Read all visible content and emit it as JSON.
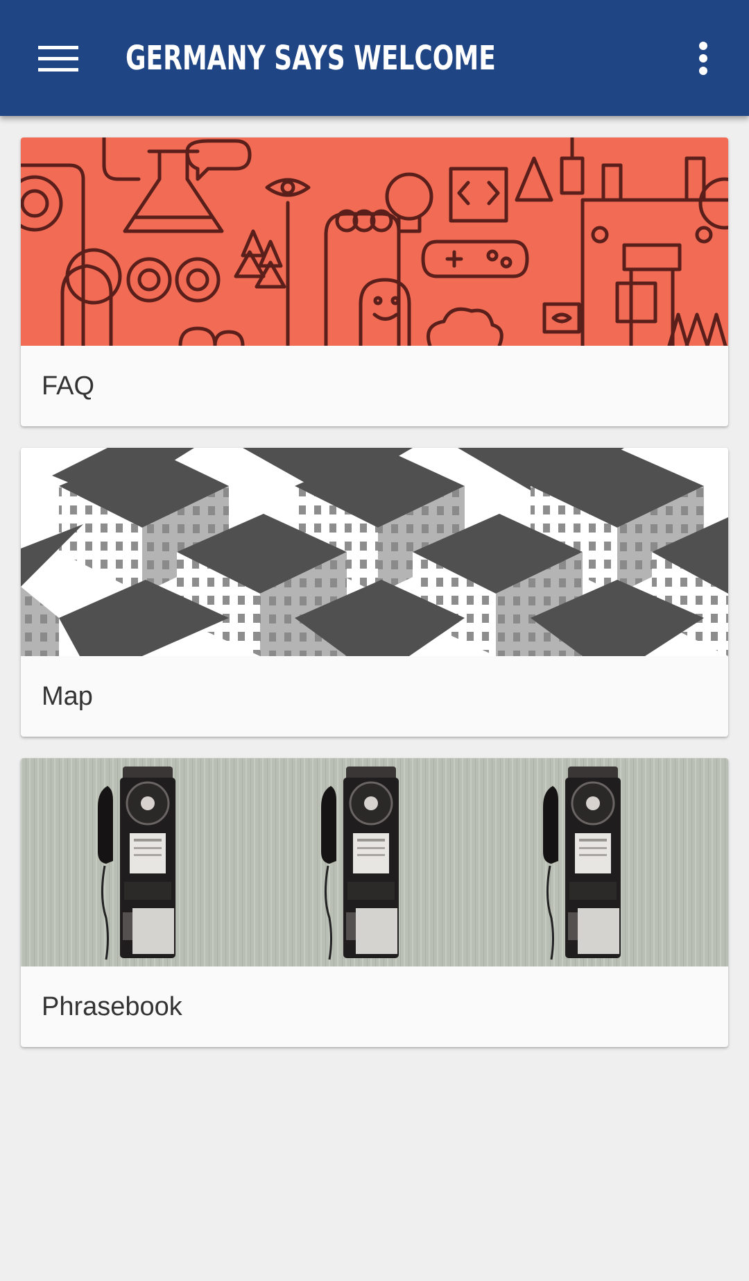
{
  "app_bar": {
    "title": "GERMANY SAYS WELCOME",
    "menu_icon": "hamburger-menu-icon",
    "overflow_icon": "more-vertical-icon",
    "background_color": "#1f4585",
    "text_color": "#ffffff"
  },
  "cards": [
    {
      "label": "FAQ",
      "image": "doodle-illustration",
      "accent_color": "#f26b55"
    },
    {
      "label": "Map",
      "image": "isometric-buildings-pattern",
      "accent_color": "#555555"
    },
    {
      "label": "Phrasebook",
      "image": "wall-payphones-photo",
      "accent_color": "#b7bdb1"
    }
  ]
}
